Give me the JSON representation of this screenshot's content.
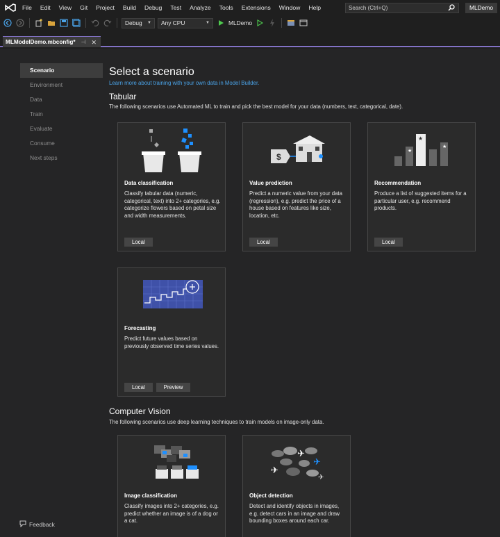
{
  "menubar": {
    "items": [
      "File",
      "Edit",
      "View",
      "Git",
      "Project",
      "Build",
      "Debug",
      "Test",
      "Analyze",
      "Tools",
      "Extensions",
      "Window",
      "Help"
    ],
    "search_placeholder": "Search (Ctrl+Q)",
    "project_name": "MLDemo"
  },
  "toolbar": {
    "configuration": "Debug",
    "platform": "Any CPU",
    "run_target": "MLDemo"
  },
  "tab": {
    "filename": "MLModelDemo.mbconfig*",
    "pin_glyph": "⊣",
    "close_glyph": "✕"
  },
  "sidebar": {
    "items": [
      {
        "label": "Scenario",
        "active": true
      },
      {
        "label": "Environment",
        "active": false
      },
      {
        "label": "Data",
        "active": false
      },
      {
        "label": "Train",
        "active": false
      },
      {
        "label": "Evaluate",
        "active": false
      },
      {
        "label": "Consume",
        "active": false
      },
      {
        "label": "Next steps",
        "active": false
      }
    ],
    "feedback_label": "Feedback"
  },
  "main": {
    "title": "Select a scenario",
    "learn_more_link": "Learn more about training with your own data in Model Builder.",
    "tabular": {
      "heading": "Tabular",
      "description": "The following scenarios use Automated ML to train and pick the best model for your data (numbers, text, categorical, date)."
    },
    "vision": {
      "heading": "Computer Vision",
      "description": "The following scenarios use deep learning techniques to train models on image-only data."
    },
    "cards": [
      {
        "title": "Data classification",
        "description": "Classify tabular data (numeric, categorical, text) into 2+ categories, e.g. categorize flowers based on petal size and width measurements.",
        "pills": [
          "Local"
        ]
      },
      {
        "title": "Value prediction",
        "description": "Predict a numeric value from your data (regression), e.g. predict the price of a house based on features like size, location, etc.",
        "pills": [
          "Local"
        ]
      },
      {
        "title": "Recommendation",
        "description": "Produce a list of suggested items for a particular user, e.g. recommend products.",
        "pills": [
          "Local"
        ]
      },
      {
        "title": "Forecasting",
        "description": "Predict future values based on previously observed time series values.",
        "pills": [
          "Local",
          "Preview"
        ]
      },
      {
        "title": "Image classification",
        "description": "Classify images into 2+ categories, e.g. predict whether an image is of a dog or a cat.",
        "pills": []
      },
      {
        "title": "Object detection",
        "description": "Detect and identify objects in images, e.g. detect cars in an image and draw bounding boxes around each car.",
        "pills": []
      }
    ]
  },
  "colors": {
    "accent": "#8272c6",
    "link": "#4aa3e8",
    "play_green": "#4ec94e",
    "card_bg": "#2b2b2b",
    "card_border": "#474747",
    "illustration_blue": "#1e90ff"
  },
  "icons": [
    "vs-logo",
    "search-icon",
    "back-icon",
    "forward-icon",
    "new-item-icon",
    "open-icon",
    "save-icon",
    "save-all-icon",
    "undo-icon",
    "redo-icon",
    "play-icon",
    "play-outline-icon",
    "feedback-icon"
  ]
}
